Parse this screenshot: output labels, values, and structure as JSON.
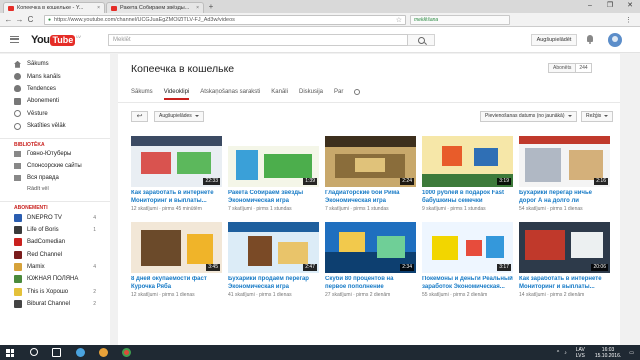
{
  "browser": {
    "tabs": [
      {
        "title": "Копеечка в кошельке - Y...",
        "close": "×"
      },
      {
        "title": "Ракета Собираем звёзды...",
        "close": "×"
      }
    ],
    "new_tab": "+",
    "window_controls": [
      "–",
      "❐",
      "✕"
    ],
    "url": "https://www.youtube.com/channel/UCGJuaEgZMOlZlTLV-FJ_Ad3w/videos",
    "extension_text": "meklēšana",
    "nav": {
      "back": "←",
      "forward": "→",
      "reload": "C"
    }
  },
  "youtube": {
    "logo_you": "You",
    "logo_tube": "Tube",
    "logo_region": "LV",
    "search_placeholder": "Meklēt",
    "upload_label": "Augšupielādēt"
  },
  "sidebar": {
    "nav": [
      {
        "label": "Sākums",
        "icon": "home-icon"
      },
      {
        "label": "Mans kanāls",
        "icon": "user-icon"
      },
      {
        "label": "Tendences",
        "icon": "fire-icon"
      },
      {
        "label": "Abonementi",
        "icon": "subscriptions-icon"
      },
      {
        "label": "Vēsture",
        "icon": "history-icon"
      },
      {
        "label": "Skatīties vēlāk",
        "icon": "watch-later-icon"
      }
    ],
    "library_title": "BIBLIOTĒKA",
    "library": [
      {
        "label": "Говно-Ютуберы"
      },
      {
        "label": "Спонсорские сайты"
      },
      {
        "label": "Вся правда"
      }
    ],
    "show_more": "Rādīt vēl",
    "subscriptions_title": "ABONEMENTI",
    "subscriptions": [
      {
        "label": "DNEPRO TV",
        "count": "4",
        "color": "#2a5db0"
      },
      {
        "label": "Life of Boris",
        "count": "1",
        "color": "#3a3a3a"
      },
      {
        "label": "BadComedian",
        "count": "",
        "color": "#c9211e"
      },
      {
        "label": "Red Channel",
        "count": "",
        "color": "#7a1c1c"
      },
      {
        "label": "Mamix",
        "count": "4",
        "color": "#d6a23a"
      },
      {
        "label": "ЮЖНАЯ ПОЛЯНА",
        "count": "",
        "color": "#4b8a3c"
      },
      {
        "label": "This is Хорошо",
        "count": "2",
        "color": "#e4c13a"
      },
      {
        "label": "Biburat Channel",
        "count": "2",
        "color": "#444"
      }
    ]
  },
  "channel": {
    "name": "Копеечка в кошельке",
    "subscribe_label": "Abonēts",
    "subscriber_count": "244",
    "tabs": [
      {
        "label": "Sākums",
        "active": false
      },
      {
        "label": "Videoklipi",
        "active": true
      },
      {
        "label": "Atskaņošanas saraksti",
        "active": false
      },
      {
        "label": "Kanāli",
        "active": false
      },
      {
        "label": "Diskusija",
        "active": false
      },
      {
        "label": "Par",
        "active": false
      }
    ],
    "back_label": "↩",
    "uploads_dropdown": "Augšupielādes",
    "sort_dropdown": "Pievienošanas datums (no jaunākā)",
    "view_dropdown": "Režģis"
  },
  "videos": [
    {
      "title": "Как заработать в интернете Мониторинг и выплаты...",
      "meta": "12 skatījumi · pirms 45 minūtēm",
      "duration": "22:33"
    },
    {
      "title": "Ракета Собираем звёзды Экономическая игра",
      "meta": "7 skatījumi · pirms 1 stundas",
      "duration": "1:39"
    },
    {
      "title": "Гладиаторские бои Рима Экономическая игра",
      "meta": "7 skatījumi · pirms 1 stundas",
      "duration": "2:24"
    },
    {
      "title": "1000 рублей в подарок Fast бабушкины семечки",
      "meta": "9 skatījumi · pirms 1 stundas",
      "duration": "3:19"
    },
    {
      "title": "Бухарики перегар ничье дорог А на долго ли",
      "meta": "54 skatījumi · pirms 1 dienas",
      "duration": "2:16"
    },
    {
      "title": "8 дней окупаемости фаст Курочка Ряба Экономическая...",
      "meta": "12 skatījumi · pirms 1 dienas",
      "duration": "3:45"
    },
    {
      "title": "Бухарики продаём перегар Экономическая игра",
      "meta": "41 skatījumi · pirms 1 dienas",
      "duration": "2:47"
    },
    {
      "title": "Скуби 80 процентов на первое пополнение Экономическая...",
      "meta": "27 skatījumi · pirms 2 dienām",
      "duration": "2:34"
    },
    {
      "title": "Покемоны и деньги Реальный заработок Экономическая...",
      "meta": "55 skatījumi · pirms 2 dienām",
      "duration": "3:17"
    },
    {
      "title": "Как заработать в интернете Мониторинг и выплаты...",
      "meta": "14 skatījumi · pirms 2 dienām",
      "duration": "20:06"
    }
  ],
  "taskbar": {
    "time": "16:03",
    "date": "15.10.2016.",
    "lang_top": "LAV",
    "lang_bottom": "LVS"
  }
}
